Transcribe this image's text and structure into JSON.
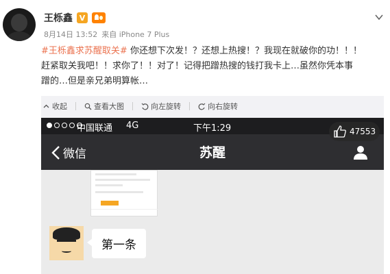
{
  "post": {
    "username": "王栎鑫",
    "verified_badge": "V",
    "date": "8月14日 13:52",
    "source": "来自 iPhone 7 Plus",
    "hashtag": "#王栎鑫求苏醒取关#",
    "body_line1": "你还想下次发！？还想上热搜！？我现在就破你的功！！！",
    "body_line2": "赶紧取关我吧！！求你了！！对了！记得把蹭热搜的钱打我卡上…虽然你凭本事",
    "body_line3": "蹭的…但是亲兄弟明算帐…",
    "colors": {
      "hashtag": "#eb7350",
      "text": "#333333",
      "meta": "#888888"
    }
  },
  "toolbar": {
    "collapse": "收起",
    "view_large": "查看大图",
    "rotate_left": "向左旋转",
    "rotate_right": "向右旋转"
  },
  "phone": {
    "carrier": "中国联通",
    "network": "4G",
    "time": "下午1:29",
    "back_label": "微信",
    "chat_title": "苏醒",
    "likes": "47553",
    "message": "第一条"
  },
  "icons": [
    "chevron-down-icon",
    "collapse-icon",
    "zoom-icon",
    "rotate-left-icon",
    "rotate-right-icon",
    "thumbs-up-icon",
    "back-arrow-icon",
    "profile-icon"
  ]
}
